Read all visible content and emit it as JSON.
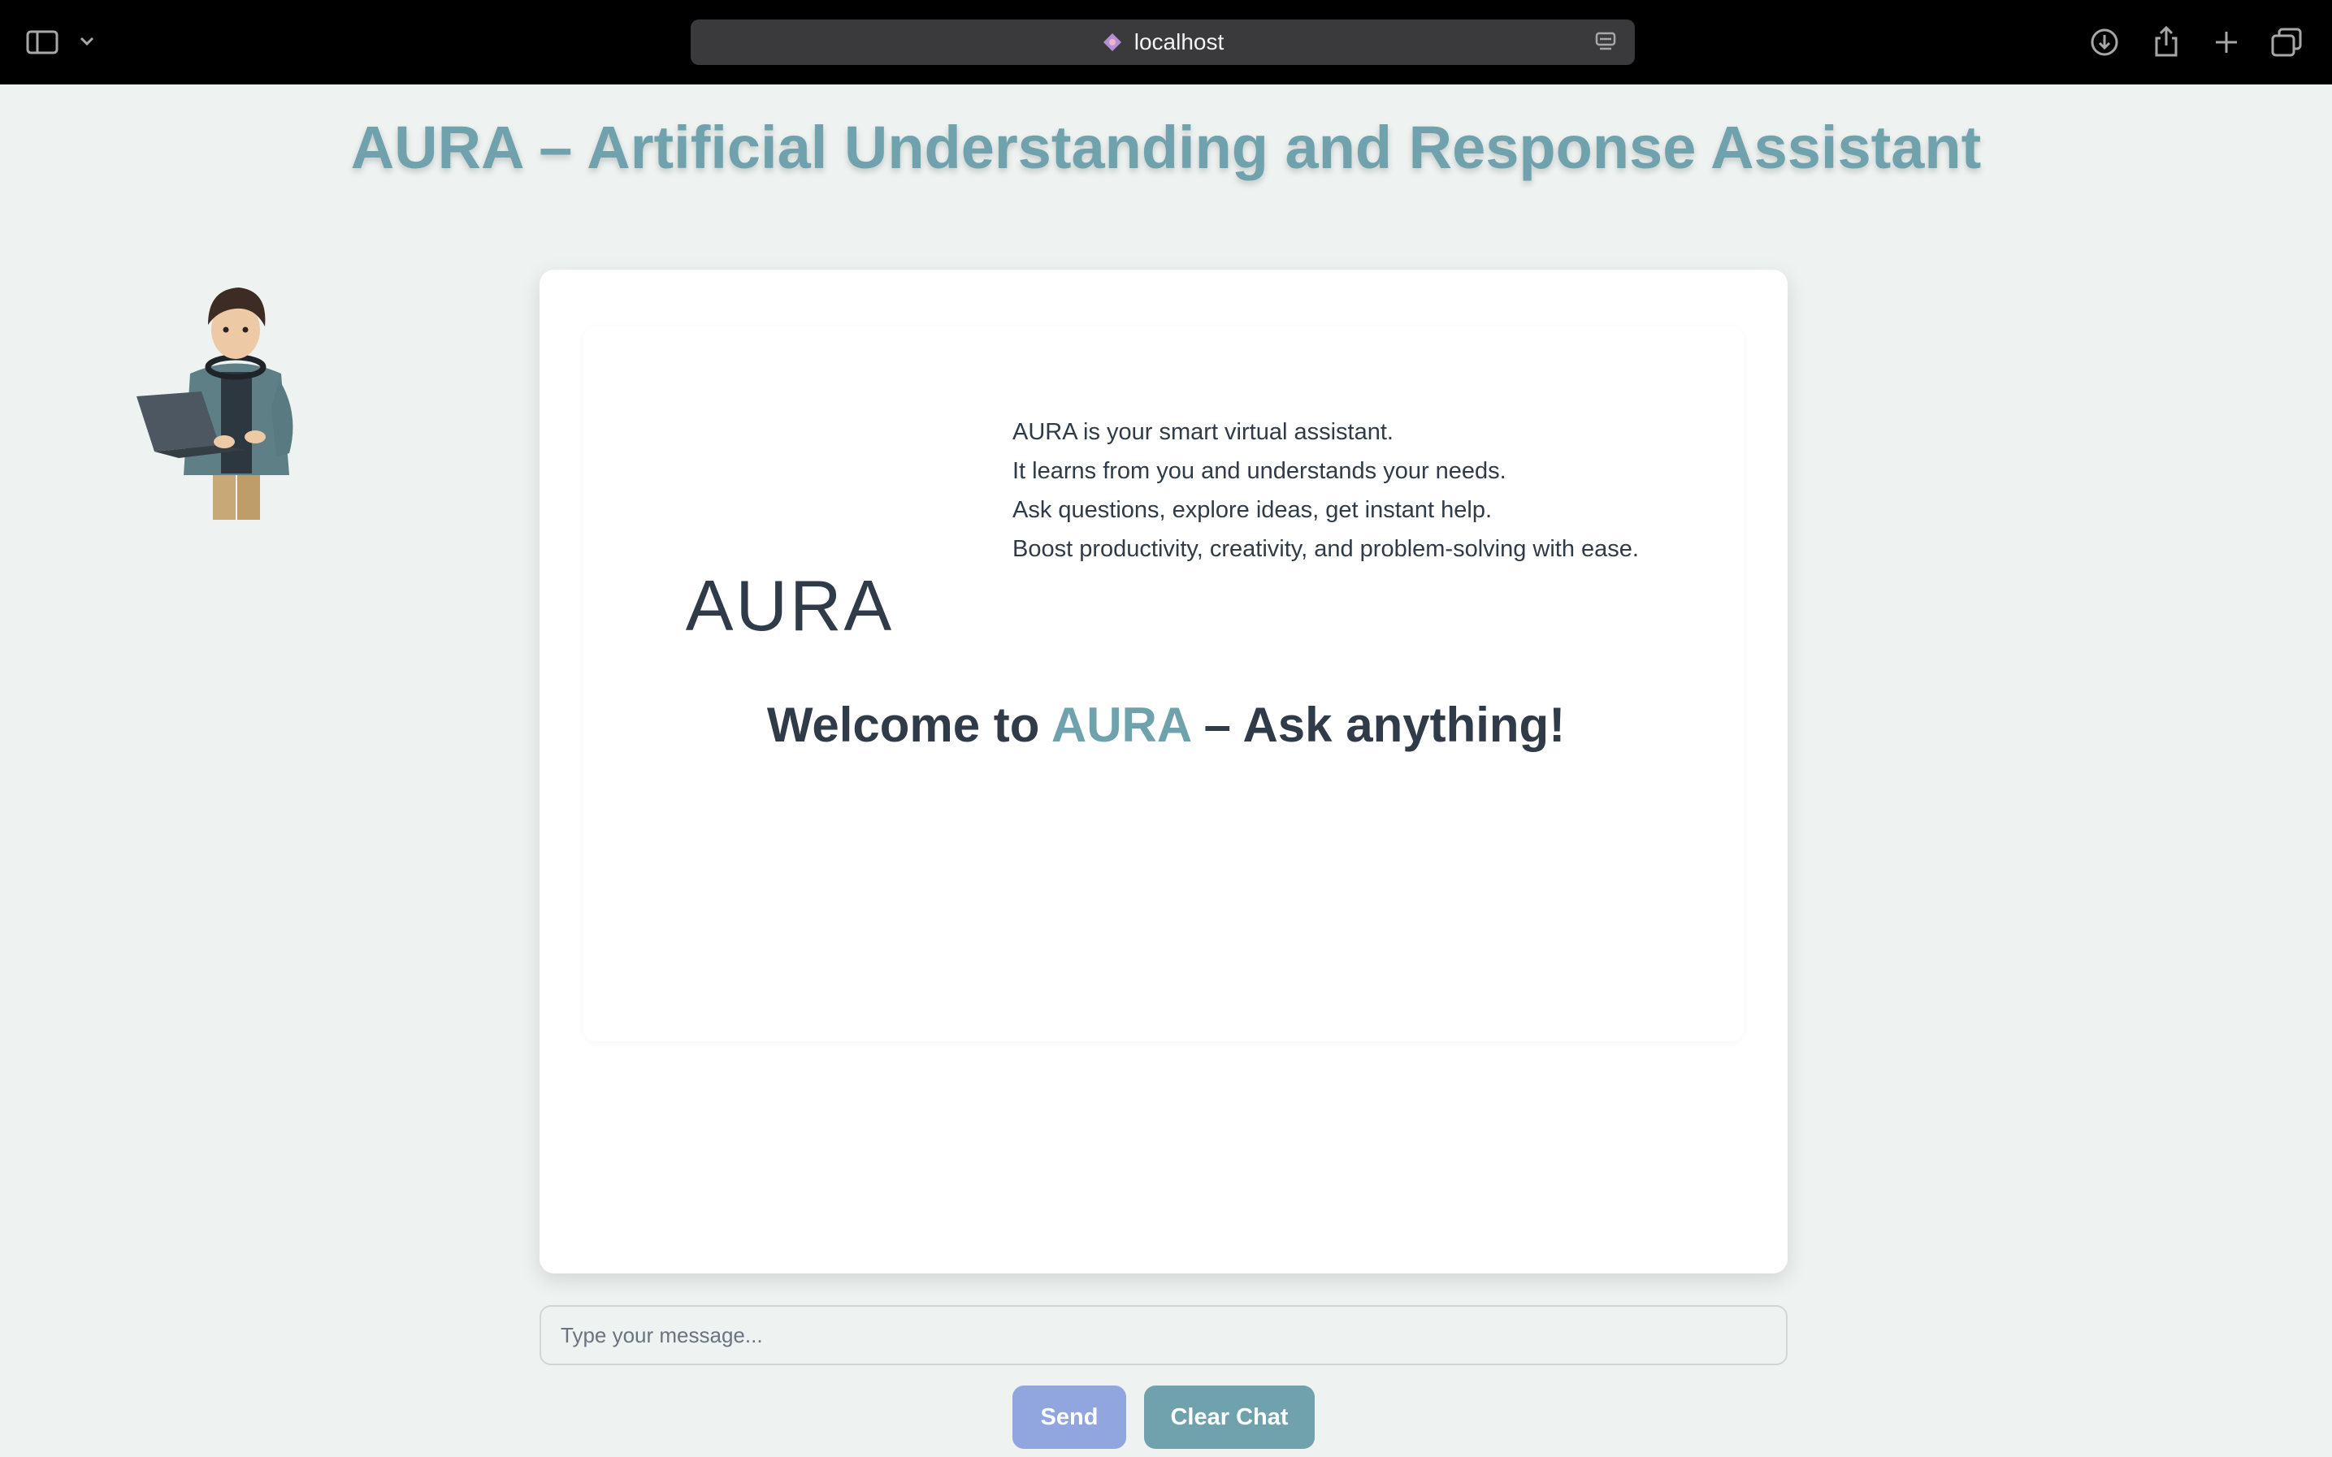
{
  "browser": {
    "url": "localhost",
    "icons": [
      "sidebar-icon",
      "chevron-down-icon",
      "site-icon",
      "reader-icon",
      "download-icon",
      "share-icon",
      "plus-icon",
      "tabs-icon"
    ]
  },
  "page": {
    "title": "AURA – Artificial Understanding and Response Assistant"
  },
  "intro": {
    "logo_word": "AURA",
    "lines": [
      "AURA is your smart virtual assistant.",
      "It learns from you and understands your needs.",
      "Ask questions, explore ideas, get instant help.",
      "Boost productivity, creativity, and problem-solving with ease."
    ],
    "welcome_prefix": "Welcome to ",
    "welcome_accent": "AURA",
    "welcome_suffix": " – Ask anything!"
  },
  "composer": {
    "placeholder": "Type your message...",
    "value": "",
    "send_label": "Send",
    "clear_label": "Clear Chat"
  },
  "colors": {
    "accent": "#6fa2ad",
    "send": "#91a6df",
    "background": "#eef3f1",
    "text": "#2f3b48"
  }
}
